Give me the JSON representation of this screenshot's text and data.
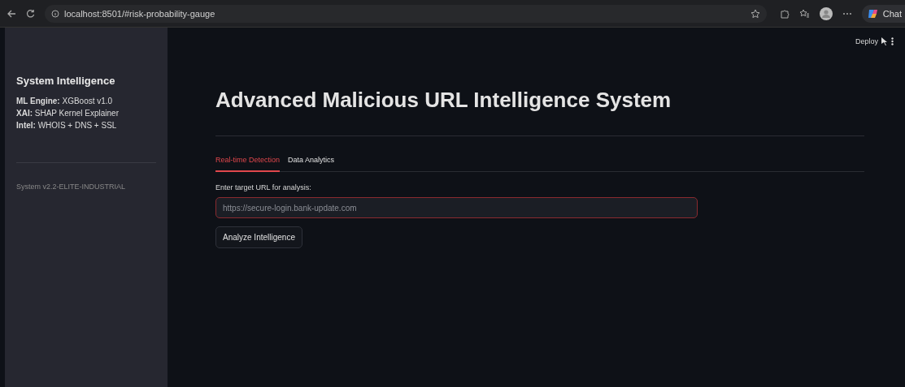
{
  "browser": {
    "url": "localhost:8501/#risk-probability-gauge",
    "assistant_label": "Chat"
  },
  "sidebar": {
    "title": "System Intelligence",
    "lines": [
      "**ML Engine:** XGBoost v1.0",
      "**XAI:** SHAP Kernel Explainer",
      "**Intel:** WHOIS + DNS + SSL"
    ],
    "version": "System v2.2-ELITE-INDUSTRIAL"
  },
  "header": {
    "deploy": "Deploy"
  },
  "title": "Advanced Malicious URL Intelligence System",
  "tabs": [
    {
      "label": "Real-time Detection",
      "selected": true
    },
    {
      "label": "Data Analytics",
      "selected": false
    }
  ],
  "url_field": {
    "label": "Enter target URL for analysis:",
    "placeholder": "https://secure-login.bank-update.com",
    "focused": true
  },
  "buttons": [
    "Analyze Intelligence"
  ]
}
